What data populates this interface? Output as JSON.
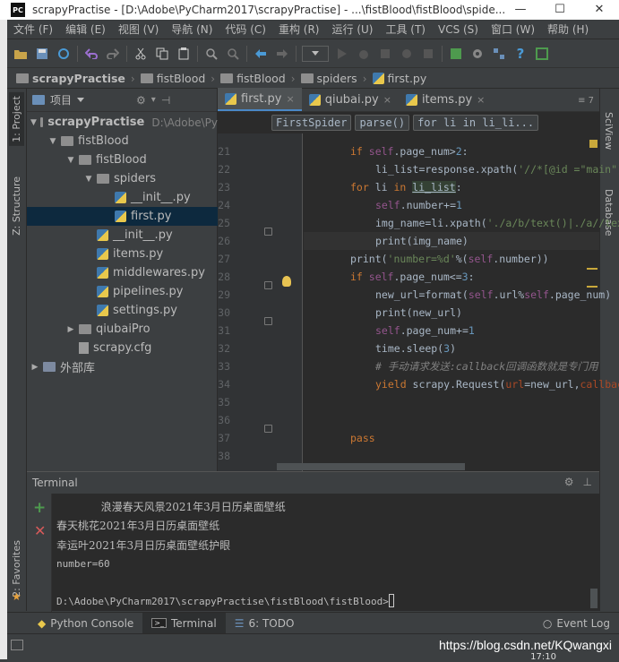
{
  "window": {
    "app_icon": "PC",
    "title": "scrapyPractise - [D:\\Adobe\\PyCharm2017\\scrapyPractise] - ...\\fistBlood\\fistBlood\\spide...",
    "min": "—",
    "max": "☐",
    "close": "✕"
  },
  "menu": [
    "文件 (F)",
    "编辑 (E)",
    "视图 (V)",
    "导航 (N)",
    "代码 (C)",
    "重构 (R)",
    "运行 (U)",
    "工具 (T)",
    "VCS (S)",
    "窗口 (W)",
    "帮助 (H)"
  ],
  "breadcrumb": [
    "scrapyPractise",
    "fistBlood",
    "fistBlood",
    "spiders",
    "first.py"
  ],
  "side_tabs": {
    "project": "1: Project",
    "structure": "Z: Structure",
    "favorites": "2: Favorites"
  },
  "right_tabs": {
    "sciview": "SciView",
    "database": "Database"
  },
  "project_panel": {
    "title": "项目",
    "tree": [
      {
        "label": "scrapyPractise",
        "extra": "D:\\Adobe\\Py",
        "depth": 0,
        "type": "folder",
        "open": true,
        "bold": true
      },
      {
        "label": "fistBlood",
        "depth": 1,
        "type": "folder",
        "open": true
      },
      {
        "label": "fistBlood",
        "depth": 2,
        "type": "folder",
        "open": true
      },
      {
        "label": "spiders",
        "depth": 3,
        "type": "folder",
        "open": true
      },
      {
        "label": "__init__.py",
        "depth": 4,
        "type": "py"
      },
      {
        "label": "first.py",
        "depth": 4,
        "type": "py",
        "selected": true
      },
      {
        "label": "__init__.py",
        "depth": 3,
        "type": "py"
      },
      {
        "label": "items.py",
        "depth": 3,
        "type": "py"
      },
      {
        "label": "middlewares.py",
        "depth": 3,
        "type": "py"
      },
      {
        "label": "pipelines.py",
        "depth": 3,
        "type": "py"
      },
      {
        "label": "settings.py",
        "depth": 3,
        "type": "py"
      },
      {
        "label": "qiubaiPro",
        "depth": 2,
        "type": "folder",
        "open": false
      },
      {
        "label": "scrapy.cfg",
        "depth": 2,
        "type": "cfg"
      },
      {
        "label": "外部库",
        "depth": 0,
        "type": "lib",
        "open": false
      }
    ]
  },
  "editor": {
    "tabs": [
      {
        "label": "first.py",
        "active": true
      },
      {
        "label": "qiubai.py",
        "active": false
      },
      {
        "label": "items.py",
        "active": false
      }
    ],
    "tabs_more": "≡ 7",
    "crumbs": [
      "FirstSpider",
      "parse()",
      "for li in li_li..."
    ],
    "line_numbers": [
      "21",
      "22",
      "23",
      "24",
      "25",
      "26",
      "27",
      "28",
      "29",
      "30",
      "31",
      "32",
      "33",
      "34",
      "35",
      "36",
      "37",
      "38"
    ]
  },
  "terminal": {
    "title": "Terminal",
    "lines": [
      "             浪漫春天风景2021年3月日历桌面壁纸",
      "春天桃花2021年3月日历桌面壁纸",
      "幸运叶2021年3月日历桌面壁纸护眼",
      "number=60",
      "",
      "D:\\Adobe\\PyCharm2017\\scrapyPractise\\fistBlood\\fistBlood>"
    ]
  },
  "bottom_tabs": [
    {
      "label": "Python Console",
      "active": false
    },
    {
      "label": "Terminal",
      "active": true
    },
    {
      "label": "6: TODO",
      "active": false
    }
  ],
  "event_log": "Event Log",
  "watermark": "https://blog.csdn.net/KQwangxi",
  "status_time": "17:10"
}
